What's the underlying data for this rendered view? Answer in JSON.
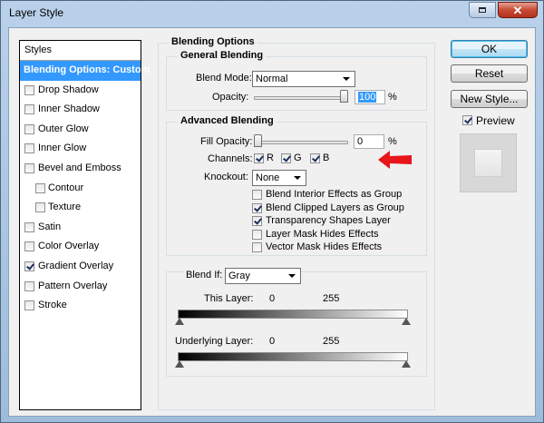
{
  "window": {
    "title": "Layer Style"
  },
  "styles_panel": {
    "header": "Styles",
    "items": [
      {
        "label": "Blending Options: Custom",
        "selected": true,
        "checkbox": false
      },
      {
        "label": "Drop Shadow",
        "checked": false
      },
      {
        "label": "Inner Shadow",
        "checked": false
      },
      {
        "label": "Outer Glow",
        "checked": false
      },
      {
        "label": "Inner Glow",
        "checked": false
      },
      {
        "label": "Bevel and Emboss",
        "checked": false
      },
      {
        "label": "Contour",
        "checked": false,
        "sub": true
      },
      {
        "label": "Texture",
        "checked": false,
        "sub": true
      },
      {
        "label": "Satin",
        "checked": false
      },
      {
        "label": "Color Overlay",
        "checked": false
      },
      {
        "label": "Gradient Overlay",
        "checked": true
      },
      {
        "label": "Pattern Overlay",
        "checked": false
      },
      {
        "label": "Stroke",
        "checked": false
      }
    ]
  },
  "blending_options": {
    "title": "Blending Options",
    "general": {
      "title": "General Blending",
      "blend_mode_label": "Blend Mode:",
      "blend_mode_value": "Normal",
      "opacity_label": "Opacity:",
      "opacity_value": "100",
      "opacity_unit": "%",
      "opacity_level": 100
    },
    "advanced": {
      "title": "Advanced Blending",
      "fill_opacity_label": "Fill Opacity:",
      "fill_opacity_value": "0",
      "fill_opacity_unit": "%",
      "fill_opacity_level": 0,
      "channels_label": "Channels:",
      "channels": [
        {
          "label": "R",
          "checked": true
        },
        {
          "label": "G",
          "checked": true
        },
        {
          "label": "B",
          "checked": true
        }
      ],
      "knockout_label": "Knockout:",
      "knockout_value": "None",
      "options": [
        {
          "label": "Blend Interior Effects as Group",
          "checked": false
        },
        {
          "label": "Blend Clipped Layers as Group",
          "checked": true
        },
        {
          "label": "Transparency Shapes Layer",
          "checked": true
        },
        {
          "label": "Layer Mask Hides Effects",
          "checked": false
        },
        {
          "label": "Vector Mask Hides Effects",
          "checked": false
        }
      ]
    },
    "blend_if": {
      "label": "Blend If:",
      "value": "Gray",
      "this_layer_label": "This Layer:",
      "this_layer_min": "0",
      "this_layer_max": "255",
      "underlying_label": "Underlying Layer:",
      "underlying_min": "0",
      "underlying_max": "255"
    }
  },
  "buttons": {
    "ok": "OK",
    "reset": "Reset",
    "new_style": "New Style...",
    "preview_label": "Preview",
    "preview_checked": true
  },
  "colors": {
    "selection": "#3399ff",
    "annotation_arrow": "#e8151b"
  }
}
